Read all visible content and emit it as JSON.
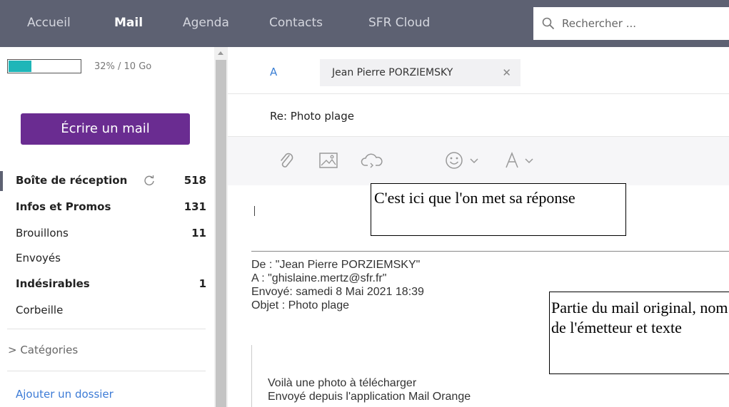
{
  "nav": {
    "items": [
      {
        "label": "Accueil",
        "active": false
      },
      {
        "label": "Mail",
        "active": true
      },
      {
        "label": "Agenda",
        "active": false
      },
      {
        "label": "Contacts",
        "active": false
      },
      {
        "label": "SFR Cloud",
        "active": false
      }
    ],
    "search_placeholder": "Rechercher ..."
  },
  "quota": {
    "text": "32% / 10 Go",
    "fraction": 0.32
  },
  "compose_button": "Écrire un mail",
  "folders": [
    {
      "name": "Boîte de réception",
      "count": "518",
      "bold": true,
      "selected": true
    },
    {
      "name": "Infos et Promos",
      "count": "131",
      "bold": true
    },
    {
      "name": "Brouillons",
      "count": "11",
      "bold": false
    },
    {
      "name": "Envoyés",
      "count": "",
      "bold": false
    },
    {
      "name": "Indésirables",
      "count": "1",
      "bold": true
    },
    {
      "name": "Corbeille",
      "count": "",
      "bold": false
    }
  ],
  "categories_label": "> Catégories",
  "add_folder_label": "Ajouter un dossier",
  "message": {
    "to_label": "A",
    "recipient": "Jean Pierre PORZIEMSKY",
    "subject": "Re: Photo plage"
  },
  "annotations": {
    "reply_note": "C'est ici que l'on met sa réponse",
    "original_note": "Partie du mail original, nom de l'émetteur et texte"
  },
  "quoted": {
    "from": "De : \"Jean Pierre PORZIEMSKY\"",
    "to": "A : \"ghislaine.mertz@sfr.fr\"",
    "sent": "Envoyé: samedi 8 Mai 2021 18:39",
    "subject": "Objet : Photo plage",
    "body_line1": "Voilà une photo à télécharger",
    "body_line2": "Envoyé depuis l'application Mail Orange"
  },
  "colors": {
    "nav_bg": "#5d6172",
    "compose_btn": "#6a2c91",
    "quota_fill": "#1fb6b8",
    "link": "#3c7bd6"
  }
}
